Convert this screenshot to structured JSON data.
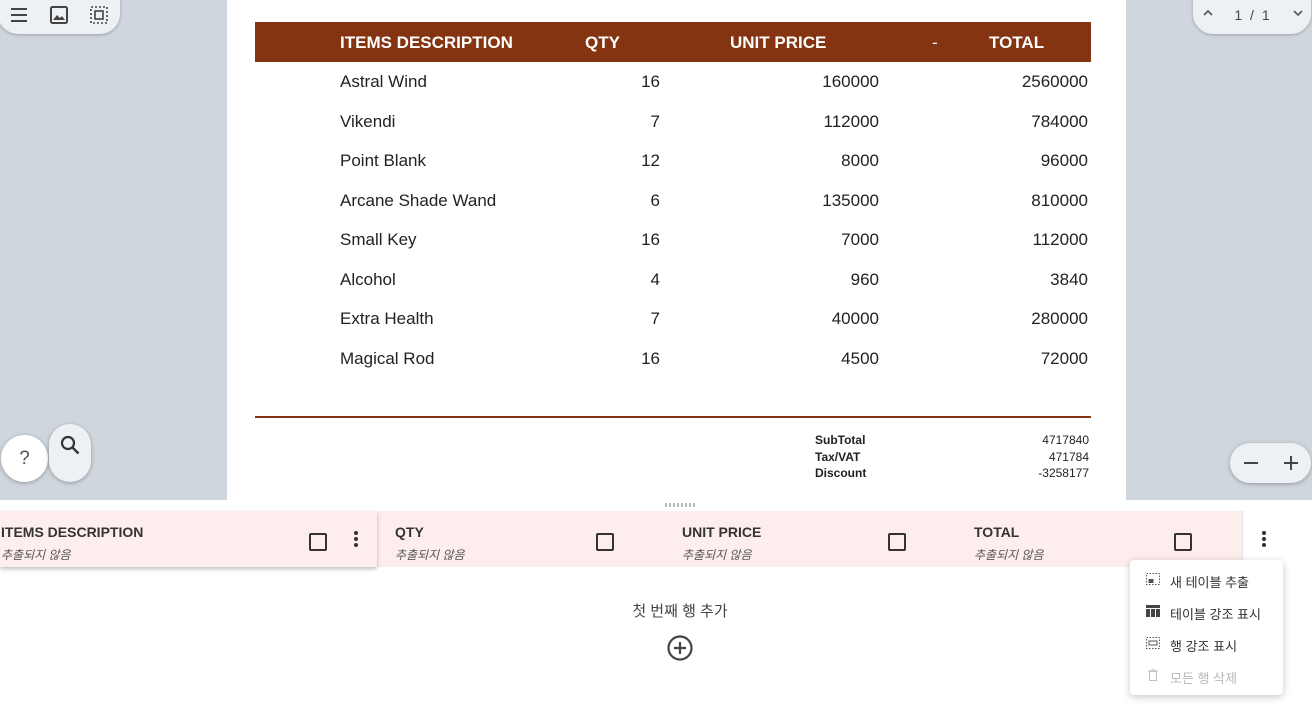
{
  "invoice": {
    "headers": {
      "description": "ITEMS DESCRIPTION",
      "qty": "QTY",
      "unit_price": "UNIT PRICE",
      "dash": "-",
      "total": "TOTAL"
    },
    "rows": [
      {
        "description": "Astral Wind",
        "qty": "16",
        "unit_price": "160000",
        "total": "2560000"
      },
      {
        "description": "Vikendi",
        "qty": "7",
        "unit_price": "112000",
        "total": "784000"
      },
      {
        "description": "Point Blank",
        "qty": "12",
        "unit_price": "8000",
        "total": "96000"
      },
      {
        "description": "Arcane Shade Wand",
        "qty": "6",
        "unit_price": "135000",
        "total": "810000"
      },
      {
        "description": "Small Key",
        "qty": "16",
        "unit_price": "7000",
        "total": "112000"
      },
      {
        "description": "Alcohol",
        "qty": "4",
        "unit_price": "960",
        "total": "3840"
      },
      {
        "description": "Extra Health",
        "qty": "7",
        "unit_price": "40000",
        "total": "280000"
      },
      {
        "description": "Magical Rod",
        "qty": "16",
        "unit_price": "4500",
        "total": "72000"
      }
    ],
    "totals": [
      {
        "label": "SubTotal",
        "value": "4717840"
      },
      {
        "label": "Tax/VAT",
        "value": "471784"
      },
      {
        "label": "Discount",
        "value": "-3258177"
      }
    ]
  },
  "pager": {
    "current": "1",
    "separator": "/",
    "total": "1"
  },
  "help": {
    "label": "?"
  },
  "extraction": {
    "columns": [
      {
        "name": "ITEMS DESCRIPTION",
        "status": "추출되지 않음"
      },
      {
        "name": "QTY",
        "status": "추출되지 않음"
      },
      {
        "name": "UNIT PRICE",
        "status": "추출되지 않음"
      },
      {
        "name": "TOTAL",
        "status": "추출되지 않음"
      }
    ],
    "add_first_row": "첫 번째 행 추가"
  },
  "context_menu": {
    "items": [
      {
        "label": "새 테이블 추출",
        "icon": "extract-table-icon",
        "disabled": false
      },
      {
        "label": "테이블 강조 표시",
        "icon": "table-icon",
        "disabled": false
      },
      {
        "label": "행 강조 표시",
        "icon": "row-select-icon",
        "disabled": false
      },
      {
        "label": "모든 행 삭제",
        "icon": "trash-icon",
        "disabled": true
      }
    ]
  },
  "colors": {
    "header_brown": "#843410",
    "column_pink": "#fdeded",
    "viewer_bg": "#cfd6dd"
  }
}
